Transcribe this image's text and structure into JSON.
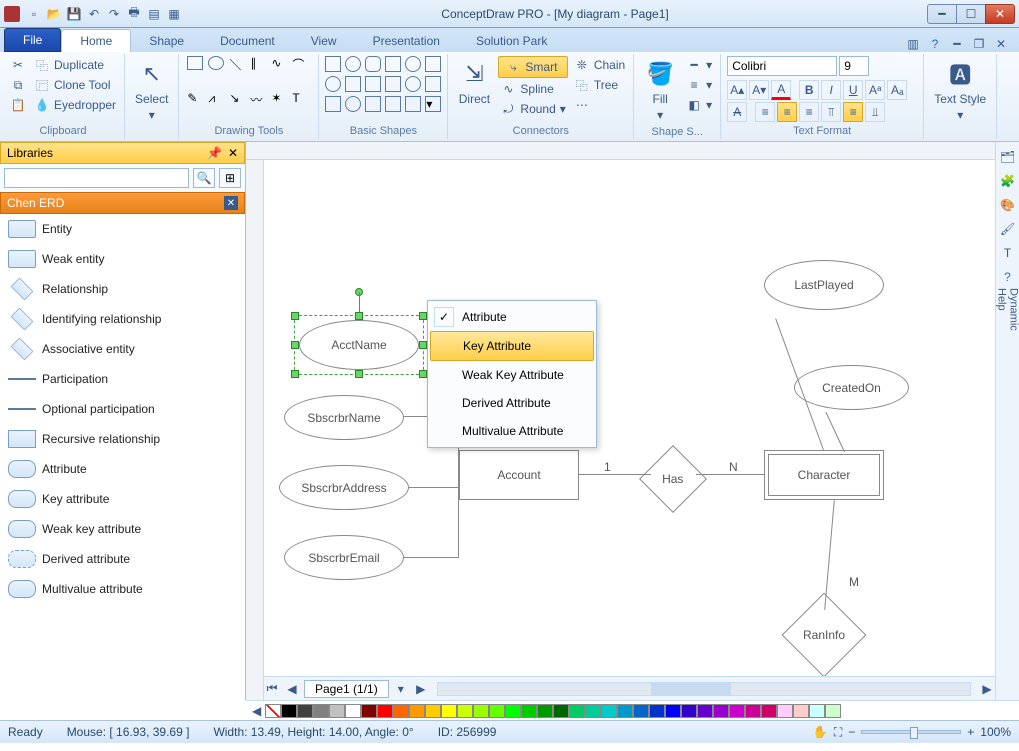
{
  "window": {
    "title": "ConceptDraw PRO - [My diagram - Page1]"
  },
  "tabs": {
    "file": "File",
    "items": [
      "Home",
      "Shape",
      "Document",
      "View",
      "Presentation",
      "Solution Park"
    ],
    "active": 0
  },
  "ribbon": {
    "clipboard": {
      "label": "Clipboard",
      "duplicate": "Duplicate",
      "clone": "Clone Tool",
      "eyedrop": "Eyedropper"
    },
    "select": {
      "label": "Select"
    },
    "drawing": {
      "label": "Drawing Tools"
    },
    "shapes": {
      "label": "Basic Shapes"
    },
    "connectors": {
      "label": "Connectors",
      "direct": "Direct",
      "smart": "Smart",
      "spline": "Spline",
      "round": "Round",
      "chain": "Chain",
      "tree": "Tree"
    },
    "fill": {
      "btn": "Fill",
      "label": "Shape S..."
    },
    "text": {
      "label": "Text Format",
      "font": "Colibri",
      "size": "9",
      "style": "Text Style"
    }
  },
  "libraries": {
    "panelTitle": "Libraries",
    "category": "Chen ERD",
    "items": [
      "Entity",
      "Weak entity",
      "Relationship",
      "Identifying relationship",
      "Associative entity",
      "Participation",
      "Optional participation",
      "Recursive relationship",
      "Attribute",
      "Key attribute",
      "Weak key attribute",
      "Derived attribute",
      "Multivalue attribute"
    ]
  },
  "contextMenu": {
    "items": [
      "Attribute",
      "Key Attribute",
      "Weak Key Attribute",
      "Derived Attribute",
      "Multivalue Attribute"
    ],
    "checked": 0,
    "highlight": 1
  },
  "diagram": {
    "acctName": "AcctName",
    "sbName": "SbscrbrName",
    "sbAddr": "SbscrbrAddress",
    "sbEmail": "SbscrbrEmail",
    "account": "Account",
    "has": "Has",
    "character": "Character",
    "lastPlayed": "LastPlayed",
    "createdOn": "CreatedOn",
    "ranInfo": "RanInfo",
    "one": "1",
    "n": "N",
    "m": "M"
  },
  "pageTab": "Page1 (1/1)",
  "colors": [
    "#000000",
    "#404040",
    "#808080",
    "#c0c0c0",
    "#ffffff",
    "#800000",
    "#ff0000",
    "#ff6600",
    "#ff9900",
    "#ffcc00",
    "#ffff00",
    "#ccff00",
    "#99ff00",
    "#66ff00",
    "#00ff00",
    "#00cc00",
    "#009900",
    "#006600",
    "#00cc66",
    "#00cc99",
    "#00cccc",
    "#0099cc",
    "#0066cc",
    "#0033cc",
    "#0000ff",
    "#3300cc",
    "#6600cc",
    "#9900cc",
    "#cc00cc",
    "#cc0099",
    "#cc0066",
    "#ffccff",
    "#ffcccc",
    "#ccffff",
    "#ccffcc"
  ],
  "status": {
    "ready": "Ready",
    "mouse": "Mouse: [ 16.93, 39.69 ]",
    "dims": "Width: 13.49,  Height: 14.00,  Angle: 0°",
    "id": "ID: 256999",
    "zoom": "100%"
  },
  "sidepanel": {
    "dynhelp": "Dynamic Help"
  }
}
